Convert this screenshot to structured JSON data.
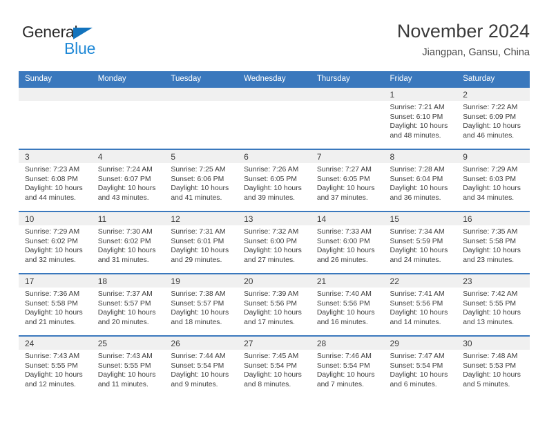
{
  "brand": {
    "name_part1": "General",
    "name_part2": "Blue",
    "triangle_icon": "triangle-icon",
    "color_dark": "#2b2b2b",
    "color_blue": "#1e88d6"
  },
  "header": {
    "title": "November 2024",
    "subtitle": "Jiangpan, Gansu, China"
  },
  "theme": {
    "header_blue": "#3a78bd",
    "daynum_bg": "#f0f0f0",
    "text": "#3b3b3b"
  },
  "weekdays": [
    "Sunday",
    "Monday",
    "Tuesday",
    "Wednesday",
    "Thursday",
    "Friday",
    "Saturday"
  ],
  "labels": {
    "sunrise": "Sunrise:",
    "sunset": "Sunset:",
    "daylight": "Daylight:"
  },
  "weeks": [
    [
      {
        "day": "",
        "empty": true
      },
      {
        "day": "",
        "empty": true
      },
      {
        "day": "",
        "empty": true
      },
      {
        "day": "",
        "empty": true
      },
      {
        "day": "",
        "empty": true
      },
      {
        "day": "1",
        "sunrise": "Sunrise: 7:21 AM",
        "sunset": "Sunset: 6:10 PM",
        "daylight": "Daylight: 10 hours and 48 minutes."
      },
      {
        "day": "2",
        "sunrise": "Sunrise: 7:22 AM",
        "sunset": "Sunset: 6:09 PM",
        "daylight": "Daylight: 10 hours and 46 minutes."
      }
    ],
    [
      {
        "day": "3",
        "sunrise": "Sunrise: 7:23 AM",
        "sunset": "Sunset: 6:08 PM",
        "daylight": "Daylight: 10 hours and 44 minutes."
      },
      {
        "day": "4",
        "sunrise": "Sunrise: 7:24 AM",
        "sunset": "Sunset: 6:07 PM",
        "daylight": "Daylight: 10 hours and 43 minutes."
      },
      {
        "day": "5",
        "sunrise": "Sunrise: 7:25 AM",
        "sunset": "Sunset: 6:06 PM",
        "daylight": "Daylight: 10 hours and 41 minutes."
      },
      {
        "day": "6",
        "sunrise": "Sunrise: 7:26 AM",
        "sunset": "Sunset: 6:05 PM",
        "daylight": "Daylight: 10 hours and 39 minutes."
      },
      {
        "day": "7",
        "sunrise": "Sunrise: 7:27 AM",
        "sunset": "Sunset: 6:05 PM",
        "daylight": "Daylight: 10 hours and 37 minutes."
      },
      {
        "day": "8",
        "sunrise": "Sunrise: 7:28 AM",
        "sunset": "Sunset: 6:04 PM",
        "daylight": "Daylight: 10 hours and 36 minutes."
      },
      {
        "day": "9",
        "sunrise": "Sunrise: 7:29 AM",
        "sunset": "Sunset: 6:03 PM",
        "daylight": "Daylight: 10 hours and 34 minutes."
      }
    ],
    [
      {
        "day": "10",
        "sunrise": "Sunrise: 7:29 AM",
        "sunset": "Sunset: 6:02 PM",
        "daylight": "Daylight: 10 hours and 32 minutes."
      },
      {
        "day": "11",
        "sunrise": "Sunrise: 7:30 AM",
        "sunset": "Sunset: 6:02 PM",
        "daylight": "Daylight: 10 hours and 31 minutes."
      },
      {
        "day": "12",
        "sunrise": "Sunrise: 7:31 AM",
        "sunset": "Sunset: 6:01 PM",
        "daylight": "Daylight: 10 hours and 29 minutes."
      },
      {
        "day": "13",
        "sunrise": "Sunrise: 7:32 AM",
        "sunset": "Sunset: 6:00 PM",
        "daylight": "Daylight: 10 hours and 27 minutes."
      },
      {
        "day": "14",
        "sunrise": "Sunrise: 7:33 AM",
        "sunset": "Sunset: 6:00 PM",
        "daylight": "Daylight: 10 hours and 26 minutes."
      },
      {
        "day": "15",
        "sunrise": "Sunrise: 7:34 AM",
        "sunset": "Sunset: 5:59 PM",
        "daylight": "Daylight: 10 hours and 24 minutes."
      },
      {
        "day": "16",
        "sunrise": "Sunrise: 7:35 AM",
        "sunset": "Sunset: 5:58 PM",
        "daylight": "Daylight: 10 hours and 23 minutes."
      }
    ],
    [
      {
        "day": "17",
        "sunrise": "Sunrise: 7:36 AM",
        "sunset": "Sunset: 5:58 PM",
        "daylight": "Daylight: 10 hours and 21 minutes."
      },
      {
        "day": "18",
        "sunrise": "Sunrise: 7:37 AM",
        "sunset": "Sunset: 5:57 PM",
        "daylight": "Daylight: 10 hours and 20 minutes."
      },
      {
        "day": "19",
        "sunrise": "Sunrise: 7:38 AM",
        "sunset": "Sunset: 5:57 PM",
        "daylight": "Daylight: 10 hours and 18 minutes."
      },
      {
        "day": "20",
        "sunrise": "Sunrise: 7:39 AM",
        "sunset": "Sunset: 5:56 PM",
        "daylight": "Daylight: 10 hours and 17 minutes."
      },
      {
        "day": "21",
        "sunrise": "Sunrise: 7:40 AM",
        "sunset": "Sunset: 5:56 PM",
        "daylight": "Daylight: 10 hours and 16 minutes."
      },
      {
        "day": "22",
        "sunrise": "Sunrise: 7:41 AM",
        "sunset": "Sunset: 5:56 PM",
        "daylight": "Daylight: 10 hours and 14 minutes."
      },
      {
        "day": "23",
        "sunrise": "Sunrise: 7:42 AM",
        "sunset": "Sunset: 5:55 PM",
        "daylight": "Daylight: 10 hours and 13 minutes."
      }
    ],
    [
      {
        "day": "24",
        "sunrise": "Sunrise: 7:43 AM",
        "sunset": "Sunset: 5:55 PM",
        "daylight": "Daylight: 10 hours and 12 minutes."
      },
      {
        "day": "25",
        "sunrise": "Sunrise: 7:43 AM",
        "sunset": "Sunset: 5:55 PM",
        "daylight": "Daylight: 10 hours and 11 minutes."
      },
      {
        "day": "26",
        "sunrise": "Sunrise: 7:44 AM",
        "sunset": "Sunset: 5:54 PM",
        "daylight": "Daylight: 10 hours and 9 minutes."
      },
      {
        "day": "27",
        "sunrise": "Sunrise: 7:45 AM",
        "sunset": "Sunset: 5:54 PM",
        "daylight": "Daylight: 10 hours and 8 minutes."
      },
      {
        "day": "28",
        "sunrise": "Sunrise: 7:46 AM",
        "sunset": "Sunset: 5:54 PM",
        "daylight": "Daylight: 10 hours and 7 minutes."
      },
      {
        "day": "29",
        "sunrise": "Sunrise: 7:47 AM",
        "sunset": "Sunset: 5:54 PM",
        "daylight": "Daylight: 10 hours and 6 minutes."
      },
      {
        "day": "30",
        "sunrise": "Sunrise: 7:48 AM",
        "sunset": "Sunset: 5:53 PM",
        "daylight": "Daylight: 10 hours and 5 minutes."
      }
    ]
  ]
}
